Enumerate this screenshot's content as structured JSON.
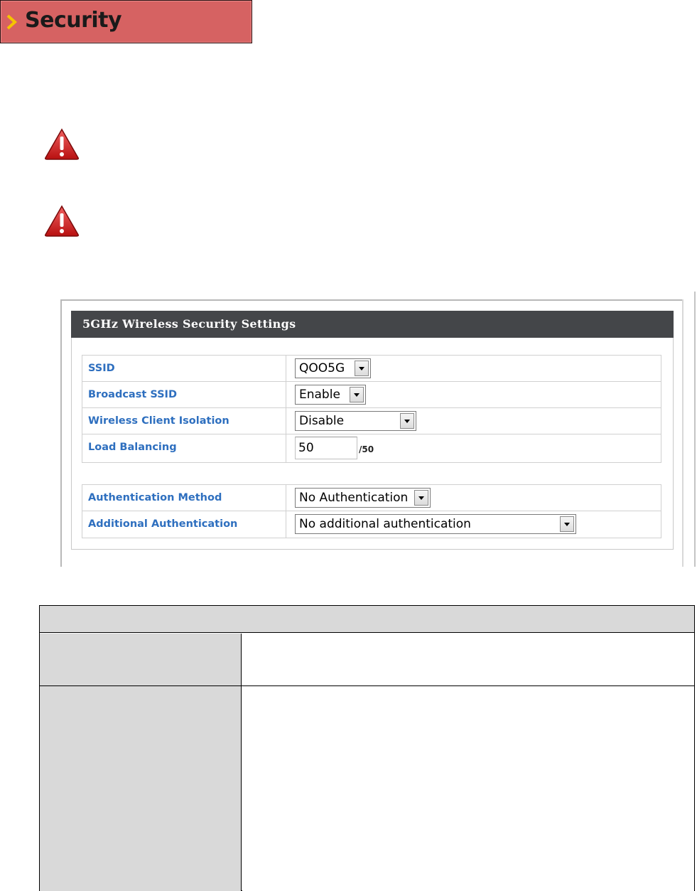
{
  "section": {
    "title": "Security",
    "banner_color": "#d66262",
    "arrow_color": "#f5c400"
  },
  "warnings": [
    {
      "icon": "warning-triangle-icon"
    },
    {
      "icon": "warning-triangle-icon"
    }
  ],
  "panel": {
    "title": "5GHz Wireless Security Settings",
    "label_color": "#2e6fbf",
    "header_color": "#444649",
    "fields": [
      {
        "label": "SSID",
        "control": "select",
        "value": "QOO5G"
      },
      {
        "label": "Broadcast SSID",
        "control": "select",
        "value": "Enable"
      },
      {
        "label": "Wireless Client Isolation",
        "control": "select",
        "value": "Disable"
      },
      {
        "label": "Load Balancing",
        "control": "text",
        "value": "50",
        "suffix": "/50"
      }
    ],
    "auth_fields": [
      {
        "label": "Authentication Method",
        "control": "select",
        "value": "No Authentication"
      },
      {
        "label": "Additional Authentication",
        "control": "select",
        "value": "No additional authentication"
      }
    ]
  }
}
